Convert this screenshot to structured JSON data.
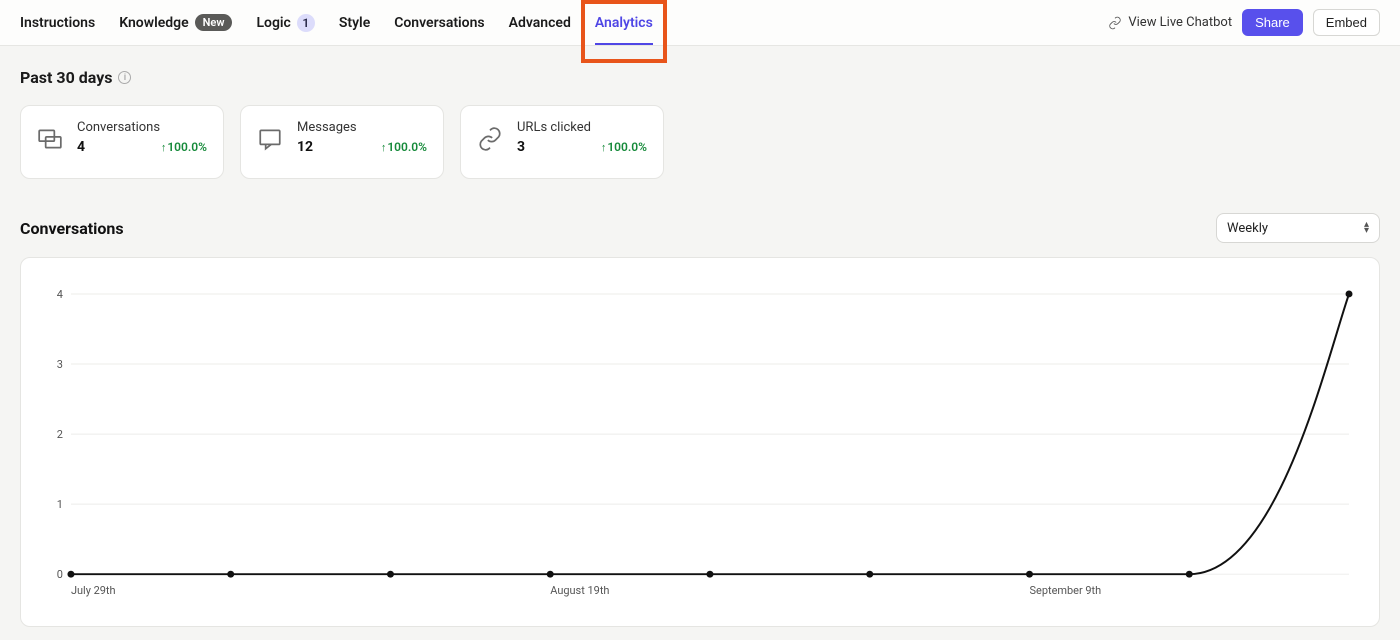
{
  "nav": {
    "tabs": {
      "instructions": "Instructions",
      "knowledge": "Knowledge",
      "knowledge_badge": "New",
      "logic": "Logic",
      "logic_count": "1",
      "style": "Style",
      "conversations": "Conversations",
      "advanced": "Advanced",
      "analytics": "Analytics"
    },
    "right": {
      "view_live": "View Live Chatbot",
      "share": "Share",
      "embed": "Embed"
    }
  },
  "summary": {
    "heading": "Past 30 days",
    "cards": [
      {
        "label": "Conversations",
        "value": "4",
        "delta": "100.0%"
      },
      {
        "label": "Messages",
        "value": "12",
        "delta": "100.0%"
      },
      {
        "label": "URLs clicked",
        "value": "3",
        "delta": "100.0%"
      }
    ]
  },
  "chart": {
    "title": "Conversations",
    "granularity": "Weekly"
  },
  "chart_data": {
    "type": "line",
    "xlabel": "",
    "ylabel": "",
    "ylim": [
      0,
      4
    ],
    "yticks": [
      0,
      1,
      2,
      3,
      4
    ],
    "x_tick_labels": [
      "July 29th",
      "August 19th",
      "September 9th"
    ],
    "x": [
      0,
      1,
      2,
      3,
      4,
      5,
      6,
      7,
      8
    ],
    "values": [
      0,
      0,
      0,
      0,
      0,
      0,
      0,
      0,
      4
    ]
  }
}
